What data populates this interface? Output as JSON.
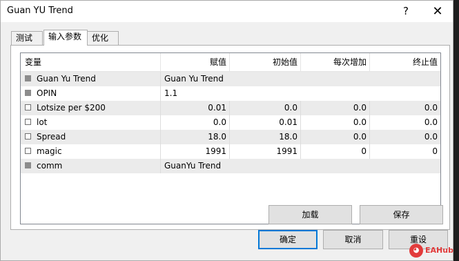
{
  "window": {
    "title": "Guan YU Trend",
    "help_label": "?",
    "close_label": "✕"
  },
  "tabs": [
    {
      "label": "测试"
    },
    {
      "label": "输入参数"
    },
    {
      "label": "优化"
    }
  ],
  "table": {
    "columns": [
      "变量",
      "赋值",
      "初始值",
      "每次增加",
      "终止值"
    ],
    "rows": [
      {
        "name": "Guan Yu Trend",
        "value": "Guan Yu Trend",
        "checkbox": "gray"
      },
      {
        "name": "OPIN",
        "value": "1.1",
        "checkbox": "gray"
      },
      {
        "name": "Lotsize per $200",
        "value": "0.01",
        "start": "0.0",
        "step": "0.0",
        "stop": "0.0",
        "checkbox": "empty"
      },
      {
        "name": "lot",
        "value": "0.0",
        "start": "0.01",
        "step": "0.0",
        "stop": "0.0",
        "checkbox": "empty"
      },
      {
        "name": "Spread",
        "value": "18.0",
        "start": "18.0",
        "step": "0.0",
        "stop": "0.0",
        "checkbox": "empty"
      },
      {
        "name": "magic",
        "value": "1991",
        "start": "1991",
        "step": "0",
        "stop": "0",
        "checkbox": "empty"
      },
      {
        "name": "comm",
        "value": "GuanYu Trend",
        "checkbox": "gray"
      }
    ]
  },
  "buttons": {
    "load": "加载",
    "save": "保存",
    "ok": "确定",
    "cancel": "取消",
    "reset": "重设"
  },
  "watermark": {
    "text": "EAHub"
  },
  "colors": {
    "default_button_border": "#0078d7",
    "alt_row": "#ebebeb",
    "watermark": "#e23b3b"
  }
}
